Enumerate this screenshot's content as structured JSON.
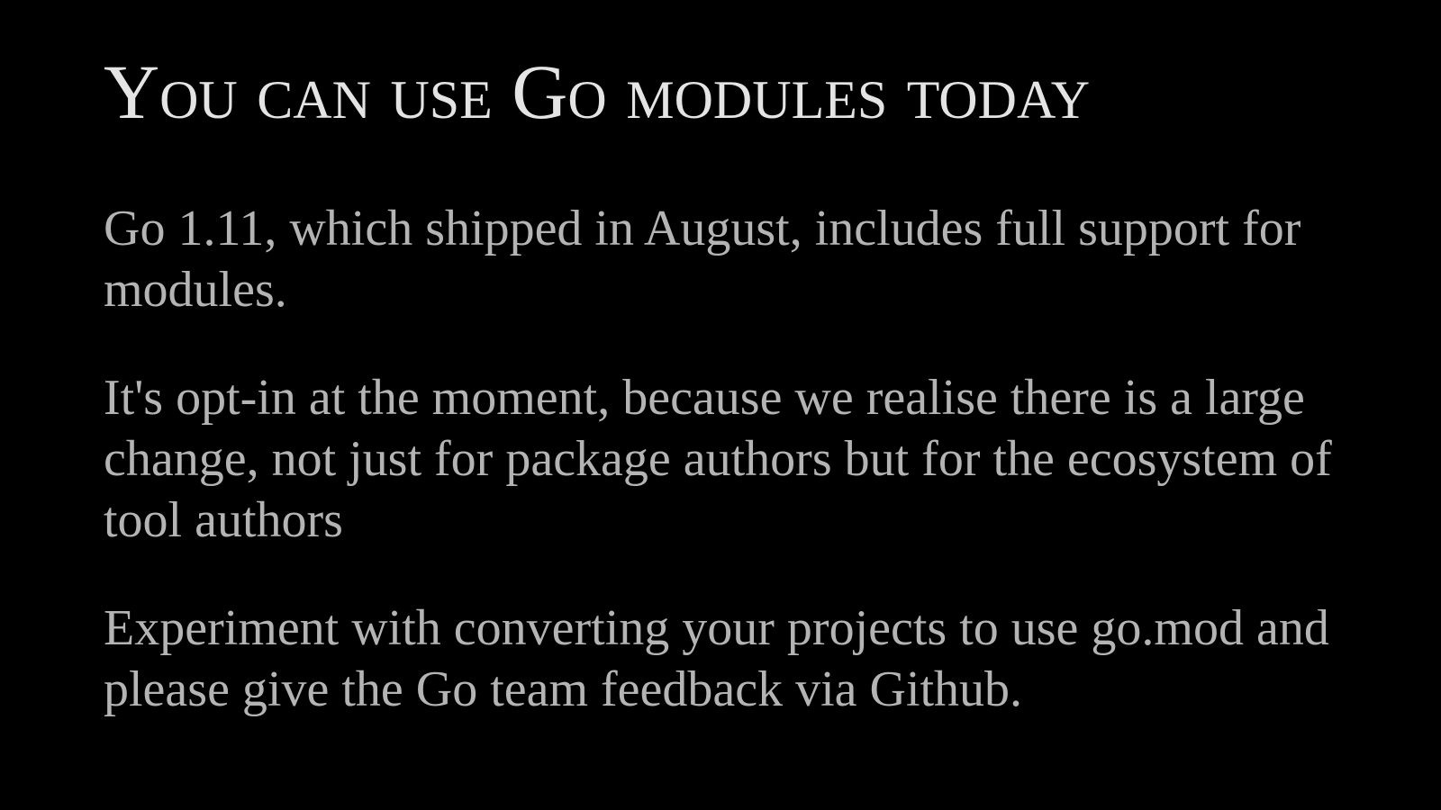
{
  "slide": {
    "title": "You can use Go modules today",
    "paragraphs": [
      "Go 1.11, which shipped in August, includes full support for modules.",
      "It's opt-in at the moment, because we realise there is a large change, not just for package authors but for the ecosystem of tool authors",
      "Experiment with converting your projects to use go.mod and please give the Go team feedback via Github."
    ]
  },
  "colors": {
    "background": "#000000",
    "title": "#e4e4e4",
    "body": "#b4b4b4"
  }
}
